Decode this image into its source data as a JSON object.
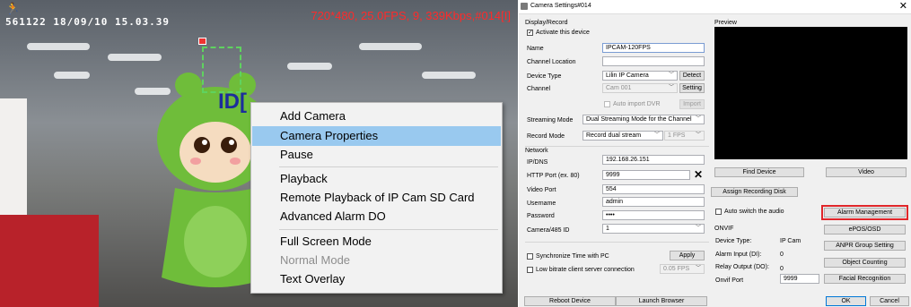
{
  "feed": {
    "timestamp": "561122  18/09/10  15.03.39",
    "stream_info": "720*480, 25.0FPS, 9, 339Kbps,#014[I]",
    "camera_label": "ID[",
    "runner_icon": "running-person-icon"
  },
  "context_menu": {
    "items": [
      {
        "label": "Add Camera",
        "state": "normal"
      },
      {
        "label": "Camera Properties",
        "state": "selected"
      },
      {
        "label": "Pause",
        "state": "normal"
      },
      {
        "label": "Playback",
        "state": "normal"
      },
      {
        "label": "Remote Playback of IP Cam SD Card",
        "state": "normal"
      },
      {
        "label": "Advanced Alarm DO",
        "state": "normal"
      },
      {
        "label": "Full Screen Mode",
        "state": "normal"
      },
      {
        "label": "Normal Mode",
        "state": "disabled"
      },
      {
        "label": "Text Overlay",
        "state": "normal"
      }
    ]
  },
  "dialog": {
    "title": "Camera Settings#014",
    "display_record": {
      "section": "Display/Record",
      "activate_label": "Activate this device",
      "activate_checked": true
    },
    "fields": {
      "name_label": "Name",
      "name_value": "IPCAM-120FPS",
      "channel_location_label": "Channel Location",
      "channel_location_value": "",
      "device_type_label": "Device Type",
      "device_type_value": "Lilin IP Camera",
      "detect_button": "Detect",
      "channel_label": "Channel",
      "channel_value": "Cam 001",
      "setting_button": "Setting",
      "auto_import_label": "Auto import DVR",
      "import_button": "Import",
      "streaming_mode_label": "Streaming Mode",
      "streaming_mode_value": "Dual Streaming Mode for the Channel",
      "record_mode_label": "Record Mode",
      "record_mode_value": "Record dual stream",
      "fps_value": "1 FPS"
    },
    "network": {
      "section": "Network",
      "ip_label": "IP/DNS",
      "ip_value": "192.168.26.151",
      "http_port_label": "HTTP Port (ex. 80)",
      "http_port_value": "9999",
      "clear_symbol": "✕",
      "video_port_label": "Video Port",
      "video_port_value": "554",
      "username_label": "Username",
      "username_value": "admin",
      "password_label": "Password",
      "password_value": "••••",
      "camera485_label": "Camera/485 ID",
      "camera485_value": "1"
    },
    "sync": {
      "sync_label": "Synchronize Time with PC",
      "apply_button": "Apply",
      "low_bitrate_label": "Low bitrate client  server connection",
      "low_bitrate_fps": "0.05 FPS"
    },
    "preview": {
      "section": "Preview",
      "find_device_button": "Find Device",
      "video_button": "Video",
      "assign_disk_button": "Assign Recording Disk",
      "auto_switch_label": "Auto switch the audio",
      "alarm_mgmt_button": "Alarm Management",
      "epos_button": "ePOS/OSD",
      "anpr_button": "ANPR Group Setting",
      "object_count_button": "Object Counting",
      "facial_button": "Facial Recognition"
    },
    "onvif": {
      "section": "ONVIF",
      "device_type_label": "Device Type:",
      "device_type_value": "IP Cam",
      "alarm_input_label": "Alarm Input (DI):",
      "alarm_input_value": "0",
      "relay_output_label": "Relay Output (DO):",
      "relay_output_value": "0",
      "onvif_port_label": "Onvif Port",
      "onvif_port_value": "9999"
    },
    "footer": {
      "reboot_button": "Reboot Device",
      "launch_browser_button": "Launch Browser",
      "ok_button": "OK",
      "cancel_button": "Cancel"
    },
    "colors": {
      "highlight": "#e0262a",
      "selection": "#99c9ef",
      "stream_info": "#ff2a2a"
    }
  }
}
